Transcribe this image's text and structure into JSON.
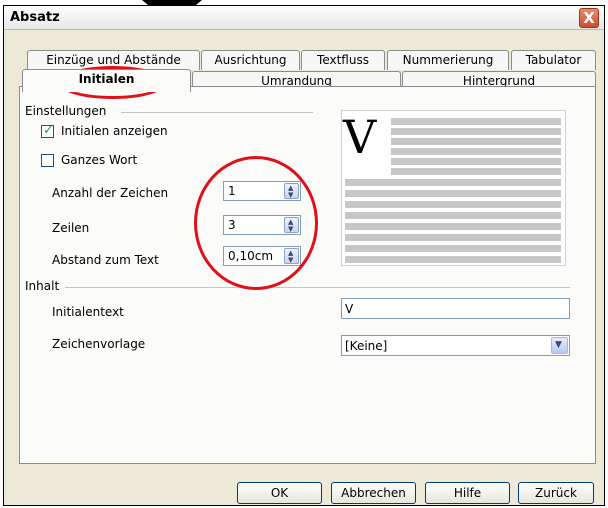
{
  "window": {
    "title": "Absatz",
    "close_glyph": "X"
  },
  "tabs_row1": [
    {
      "label": "Einzüge und Abstände"
    },
    {
      "label": "Ausrichtung"
    },
    {
      "label": "Textfluss"
    },
    {
      "label": "Nummerierung"
    },
    {
      "label": "Tabulator"
    }
  ],
  "tabs_row2": [
    {
      "label": "Initialen",
      "active": true
    },
    {
      "label": "Umrandung"
    },
    {
      "label": "Hintergrund"
    }
  ],
  "settings": {
    "group_label": "Einstellungen",
    "show_initials": {
      "label": "Initialen anzeigen",
      "checked": true
    },
    "whole_word": {
      "label": "Ganzes Wort",
      "checked": false
    },
    "char_count": {
      "label": "Anzahl der Zeichen",
      "value": "1"
    },
    "lines": {
      "label": "Zeilen",
      "value": "3"
    },
    "distance": {
      "label": "Abstand zum Text",
      "value": "0,10cm"
    }
  },
  "preview": {
    "initial_letter": "V"
  },
  "content": {
    "group_label": "Inhalt",
    "initial_text": {
      "label": "Initialentext",
      "value": "V"
    },
    "char_style": {
      "label": "Zeichenvorlage",
      "value": "[Keine]"
    }
  },
  "buttons": {
    "ok": "OK",
    "cancel": "Abbrechen",
    "help": "Hilfe",
    "back": "Zurück"
  },
  "icons": {
    "close": "close-icon",
    "spin": "spin-arrows-icon",
    "dropdown": "chevron-down-icon",
    "check": "checkmark-icon"
  },
  "colors": {
    "annotation": "#e0101b",
    "close_button": "#c8502c",
    "check_green": "#21a121"
  }
}
